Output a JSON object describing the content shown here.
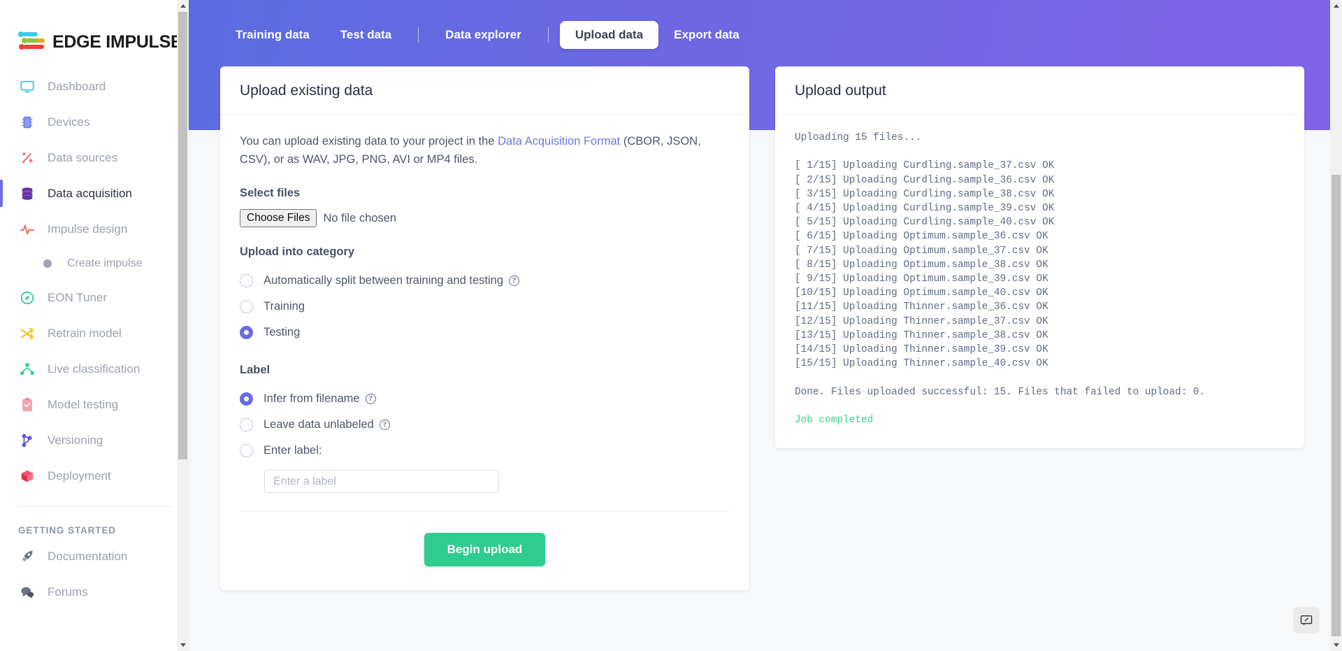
{
  "brand": {
    "name": "EDGE IMPULSE",
    "logo_colors": [
      "#3bc9e8",
      "#8cc63f",
      "#f7a41d",
      "#ef4136"
    ]
  },
  "colors": {
    "accent_purple": "#6b6be8",
    "header_gradient_start": "#5b6ce0",
    "header_gradient_end": "#8164e8",
    "success_green": "#2ecc8f",
    "log_success_text": "#3ecf8e",
    "link_blue": "#6a77e0"
  },
  "sidebar": {
    "items": [
      {
        "label": "Dashboard",
        "icon": "monitor-icon",
        "active": false
      },
      {
        "label": "Devices",
        "icon": "chip-icon",
        "active": false
      },
      {
        "label": "Data sources",
        "icon": "wand-icon",
        "active": false
      },
      {
        "label": "Data acquisition",
        "icon": "database-icon",
        "active": true
      },
      {
        "label": "Impulse design",
        "icon": "pulse-icon",
        "active": false
      }
    ],
    "sub_items": [
      {
        "label": "Create impulse",
        "icon": "bullet-dot-icon"
      }
    ],
    "items2": [
      {
        "label": "EON Tuner",
        "icon": "compass-icon",
        "active": false
      },
      {
        "label": "Retrain model",
        "icon": "shuffle-icon",
        "active": false
      },
      {
        "label": "Live classification",
        "icon": "network-icon",
        "active": false
      },
      {
        "label": "Model testing",
        "icon": "clipboard-check-icon",
        "active": false
      },
      {
        "label": "Versioning",
        "icon": "git-branch-icon",
        "active": false
      },
      {
        "label": "Deployment",
        "icon": "box-icon",
        "active": false
      }
    ],
    "section_title": "GETTING STARTED",
    "footer_items": [
      {
        "label": "Documentation",
        "icon": "rocket-icon"
      },
      {
        "label": "Forums",
        "icon": "chat-bubbles-icon"
      }
    ]
  },
  "tabs": [
    {
      "label": "Training data",
      "active": false,
      "sep_after": false
    },
    {
      "label": "Test data",
      "active": false,
      "sep_after": true
    },
    {
      "label": "Data explorer",
      "active": false,
      "sep_after": true
    },
    {
      "label": "Upload data",
      "active": true,
      "sep_after": false
    },
    {
      "label": "Export data",
      "active": false,
      "sep_after": false
    }
  ],
  "upload_card": {
    "title": "Upload existing data",
    "intro_prefix": "You can upload existing data to your project in the ",
    "intro_link": "Data Acquisition Format",
    "intro_suffix": " (CBOR, JSON, CSV), or as WAV, JPG, PNG, AVI or MP4 files.",
    "select_files_label": "Select files",
    "choose_files_button": "Choose Files",
    "no_file_chosen": "No file chosen",
    "category_label": "Upload into category",
    "category_options": [
      {
        "label": "Automatically split between training and testing",
        "checked": false,
        "has_help": true
      },
      {
        "label": "Training",
        "checked": false,
        "has_help": false
      },
      {
        "label": "Testing",
        "checked": true,
        "has_help": false
      }
    ],
    "label_section_label": "Label",
    "label_options": [
      {
        "label": "Infer from filename",
        "checked": true,
        "has_help": true
      },
      {
        "label": "Leave data unlabeled",
        "checked": false,
        "has_help": true
      },
      {
        "label": "Enter label:",
        "checked": false,
        "has_help": false
      }
    ],
    "label_input_value": "",
    "label_input_placeholder": "Enter a label",
    "begin_upload_button": "Begin upload",
    "help_glyph": "?"
  },
  "output_card": {
    "title": "Upload output",
    "lines": [
      {
        "text": "Uploading 15 files...",
        "success": false
      },
      {
        "text": "",
        "success": false
      },
      {
        "text": "[ 1/15] Uploading Curdling.sample_37.csv OK",
        "success": false
      },
      {
        "text": "[ 2/15] Uploading Curdling.sample_36.csv OK",
        "success": false
      },
      {
        "text": "[ 3/15] Uploading Curdling.sample_38.csv OK",
        "success": false
      },
      {
        "text": "[ 4/15] Uploading Curdling.sample_39.csv OK",
        "success": false
      },
      {
        "text": "[ 5/15] Uploading Curdling.sample_40.csv OK",
        "success": false
      },
      {
        "text": "[ 6/15] Uploading Optimum.sample_36.csv OK",
        "success": false
      },
      {
        "text": "[ 7/15] Uploading Optimum.sample_37.csv OK",
        "success": false
      },
      {
        "text": "[ 8/15] Uploading Optimum.sample_38.csv OK",
        "success": false
      },
      {
        "text": "[ 9/15] Uploading Optimum.sample_39.csv OK",
        "success": false
      },
      {
        "text": "[10/15] Uploading Optimum.sample_40.csv OK",
        "success": false
      },
      {
        "text": "[11/15] Uploading Thinner.sample_36.csv OK",
        "success": false
      },
      {
        "text": "[12/15] Uploading Thinner.sample_37.csv OK",
        "success": false
      },
      {
        "text": "[13/15] Uploading Thinner.sample_38.csv OK",
        "success": false
      },
      {
        "text": "[14/15] Uploading Thinner.sample_39.csv OK",
        "success": false
      },
      {
        "text": "[15/15] Uploading Thinner.sample_40.csv OK",
        "success": false
      },
      {
        "text": "",
        "success": false
      },
      {
        "text": "Done. Files uploaded successful: 15. Files that failed to upload: 0.",
        "success": false
      },
      {
        "text": "",
        "success": false
      },
      {
        "text": "Job completed",
        "success": true
      }
    ]
  },
  "feedback": {
    "icon": "feedback-screen-icon"
  }
}
